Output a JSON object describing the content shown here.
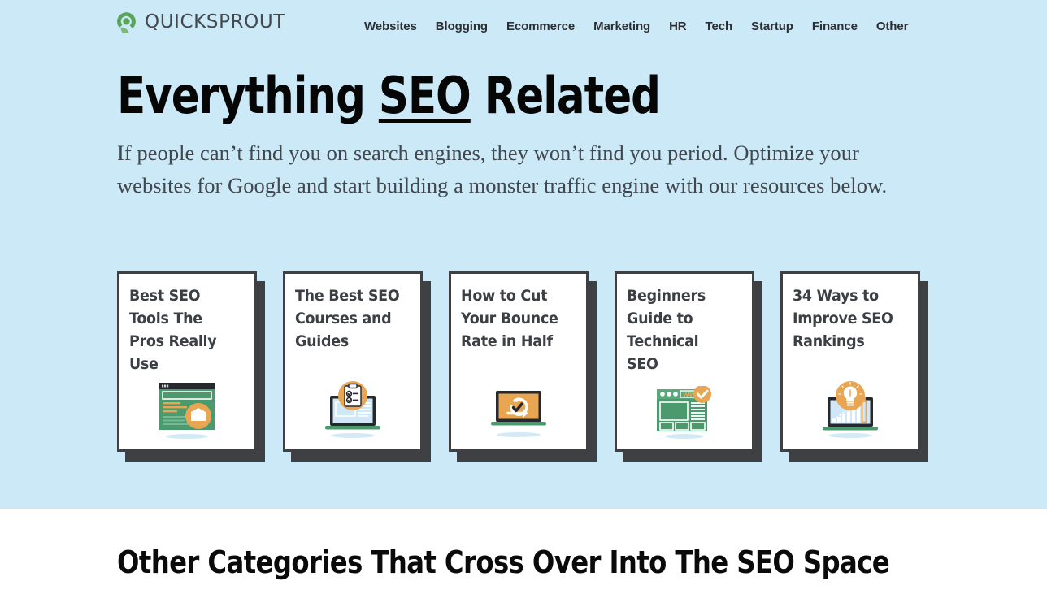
{
  "header": {
    "brand": {
      "name": "QUICKSPROUT",
      "mark_icon": "quicksprout-leaf-icon",
      "mark_color": "#5aa35a"
    },
    "nav": [
      {
        "label": "Websites"
      },
      {
        "label": "Blogging"
      },
      {
        "label": "Ecommerce"
      },
      {
        "label": "Marketing"
      },
      {
        "label": "HR"
      },
      {
        "label": "Tech"
      },
      {
        "label": "Startup"
      },
      {
        "label": "Finance"
      },
      {
        "label": "Other"
      }
    ]
  },
  "hero": {
    "background_color": "#cce9f7",
    "headline": {
      "before": "Everything ",
      "emphasis": "SEO",
      "after": " Related"
    },
    "subtitle": "If people can’t find you on search engines, they won’t find you period. Optimize your websites for Google and start building a monster traffic engine with our resources below."
  },
  "cards": [
    {
      "title": "Best SEO Tools The Pros Really Use",
      "art_icon": "green-browser-envelope-icon"
    },
    {
      "title": "The Best SEO Courses and Guides",
      "art_icon": "laptop-clipboard-checklist-icon"
    },
    {
      "title": "How to Cut Your Bounce Rate in Half",
      "art_icon": "laptop-bounce-arrow-icon"
    },
    {
      "title": "Beginners Guide to Technical SEO",
      "art_icon": "www-browser-check-icon"
    },
    {
      "title": "34 Ways to Improve SEO Rankings",
      "art_icon": "laptop-growth-chart-bulb-icon"
    }
  ],
  "lower_section": {
    "heading": "Other Categories That Cross Over Into The SEO Space",
    "background_color": "#ffffff"
  },
  "theme": {
    "accent_orange": "#e8a552",
    "accent_green": "#4b9a6e",
    "ink": "#3e4044",
    "hero_blue": "#cce9f7"
  }
}
